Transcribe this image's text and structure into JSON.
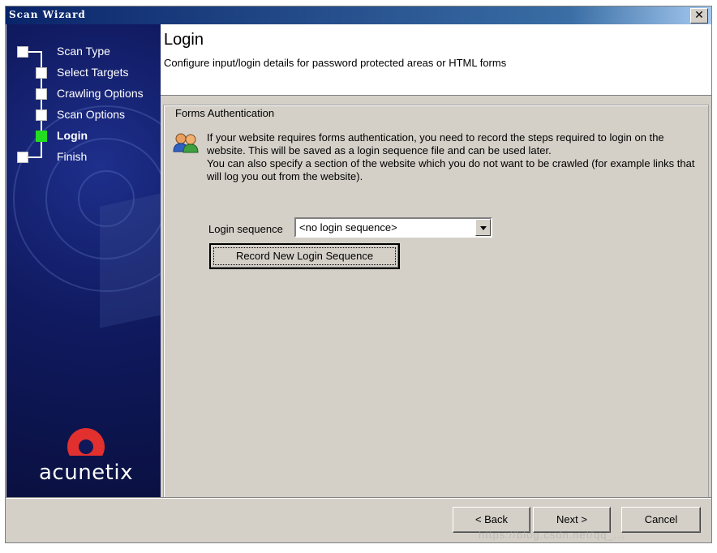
{
  "window": {
    "title": "Scan Wizard",
    "close_glyph": "✕"
  },
  "sidebar": {
    "steps": [
      {
        "label": "Scan Type",
        "state": "done"
      },
      {
        "label": "Select Targets",
        "state": "done"
      },
      {
        "label": "Crawling Options",
        "state": "done"
      },
      {
        "label": "Scan Options",
        "state": "done"
      },
      {
        "label": "Login",
        "state": "active"
      },
      {
        "label": "Finish",
        "state": "pending"
      }
    ],
    "logo_text": "acunetix"
  },
  "header": {
    "title": "Login",
    "description": "Configure input/login details for password protected areas or HTML forms"
  },
  "forms_auth": {
    "legend": "Forms Authentication",
    "info_line1": "If your website requires forms authentication, you need to record the steps required to login on the website. This will be saved as a login sequence file and can be used later.",
    "info_line2": "You can also specify a section of the website which you do not want to be crawled (for example links that will log you out from the website).",
    "login_sequence_label": "Login sequence",
    "login_sequence_value": "<no login sequence>",
    "record_button": "Record New Login Sequence"
  },
  "footer": {
    "back_button": "< Back",
    "next_button": "Next >",
    "cancel_button": "Cancel"
  },
  "watermark": "https://blog.csdn.net/qq_...",
  "colors": {
    "titlebar": "#0a246a",
    "sidebar": "#101a60",
    "active_step": "#22dd22",
    "logo_red": "#e2302f",
    "dialog_bg": "#d4d0c8"
  }
}
